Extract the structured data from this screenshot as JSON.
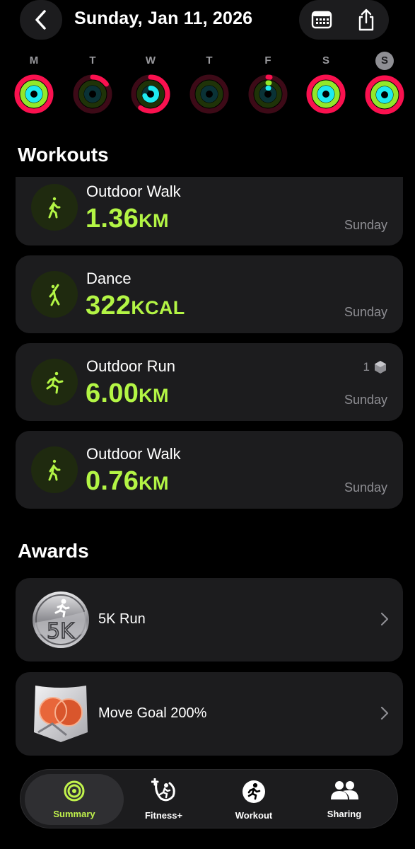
{
  "header": {
    "title": "Sunday, Jan 11, 2026",
    "back_icon": "chevron-left-icon",
    "calendar_icon": "calendar-icon",
    "share_icon": "share-icon"
  },
  "week": {
    "days": [
      {
        "label": "M",
        "move": 1.0,
        "exercise": 1.0,
        "stand": 1.0,
        "selected": false
      },
      {
        "label": "T",
        "move": 0.15,
        "exercise": 0.0,
        "stand": 0.0,
        "selected": false
      },
      {
        "label": "W",
        "move": 0.6,
        "exercise": 0.0,
        "stand": 0.7,
        "selected": false
      },
      {
        "label": "T",
        "move": 0.0,
        "exercise": 0.0,
        "stand": 0.0,
        "selected": false
      },
      {
        "label": "F",
        "move": 0.02,
        "exercise": 0.02,
        "stand": 0.02,
        "selected": false
      },
      {
        "label": "S",
        "move": 1.0,
        "exercise": 1.0,
        "stand": 1.0,
        "selected": false
      },
      {
        "label": "S",
        "move": 1.0,
        "exercise": 1.0,
        "stand": 1.0,
        "selected": true
      }
    ],
    "colors": {
      "move": "#fa114f",
      "exercise": "#92e82a",
      "stand": "#1eeaef"
    }
  },
  "workouts_title": "Workouts",
  "workouts": [
    {
      "name": "Outdoor Walk",
      "value": "1.36",
      "unit": "KM",
      "day": "Sunday",
      "icon": "walk-icon",
      "badge": ""
    },
    {
      "name": "Dance",
      "value": "322",
      "unit": "KCAL",
      "day": "Sunday",
      "icon": "dance-icon",
      "badge": ""
    },
    {
      "name": "Outdoor Run",
      "value": "6.00",
      "unit": "KM",
      "day": "Sunday",
      "icon": "run-icon",
      "badge": "1"
    },
    {
      "name": "Outdoor Walk",
      "value": "0.76",
      "unit": "KM",
      "day": "Sunday",
      "icon": "walk-icon",
      "badge": ""
    }
  ],
  "awards_title": "Awards",
  "awards": [
    {
      "name": "5K Run",
      "icon": "5k-run-medal-icon"
    },
    {
      "name": "Move Goal 200%",
      "icon": "move-goal-200-medal-icon"
    }
  ],
  "tabs": [
    {
      "label": "Summary",
      "icon": "summary-rings-icon",
      "active": true
    },
    {
      "label": "Fitness+",
      "icon": "fitness-plus-icon",
      "active": false
    },
    {
      "label": "Workout",
      "icon": "workout-runner-icon",
      "active": false
    },
    {
      "label": "Sharing",
      "icon": "sharing-people-icon",
      "active": false
    }
  ],
  "accent_color": "#b3f545"
}
